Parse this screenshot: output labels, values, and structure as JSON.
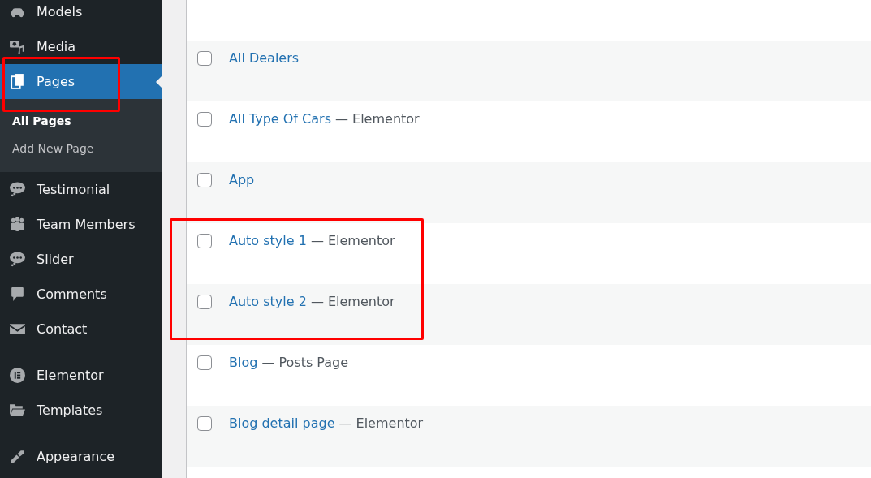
{
  "sidebar": {
    "groups": [
      [
        {
          "label": "Models",
          "selected": false,
          "outlined": false
        },
        {
          "label": "Media",
          "selected": false,
          "outlined": false
        },
        {
          "label": "Pages",
          "selected": true,
          "outlined": true,
          "children": [
            {
              "label": "All Pages",
              "selected": true
            },
            {
              "label": "Add New Page",
              "selected": false
            }
          ]
        },
        {
          "label": "Testimonial",
          "selected": false,
          "outlined": false
        },
        {
          "label": "Team Members",
          "selected": false,
          "outlined": false
        },
        {
          "label": "Slider",
          "selected": false,
          "outlined": false
        },
        {
          "label": "Comments",
          "selected": false,
          "outlined": false
        },
        {
          "label": "Contact",
          "selected": false,
          "outlined": false
        }
      ],
      [
        {
          "label": "Elementor",
          "selected": false,
          "outlined": false
        },
        {
          "label": "Templates",
          "selected": false,
          "outlined": false
        }
      ],
      [
        {
          "label": "Appearance",
          "selected": false,
          "outlined": false
        }
      ]
    ]
  },
  "pages": {
    "rows": [
      {
        "title": "All Dealers",
        "checked": false,
        "outlined": false
      },
      {
        "title": "All Type Of Cars",
        "post_state": "— Elementor",
        "checked": false,
        "outlined": false
      },
      {
        "title": "App",
        "checked": false,
        "outlined": false
      },
      {
        "title": "Auto style 1",
        "post_state": "— Elementor",
        "checked": false,
        "outlined": true
      },
      {
        "title": "Auto style 2",
        "post_state": "— Elementor",
        "checked": false,
        "outlined": true
      },
      {
        "title": "Blog",
        "post_state": "— Posts Page",
        "checked": false,
        "outlined": false
      },
      {
        "title": "Blog detail page",
        "post_state": "— Elementor",
        "checked": false,
        "outlined": false
      }
    ]
  }
}
